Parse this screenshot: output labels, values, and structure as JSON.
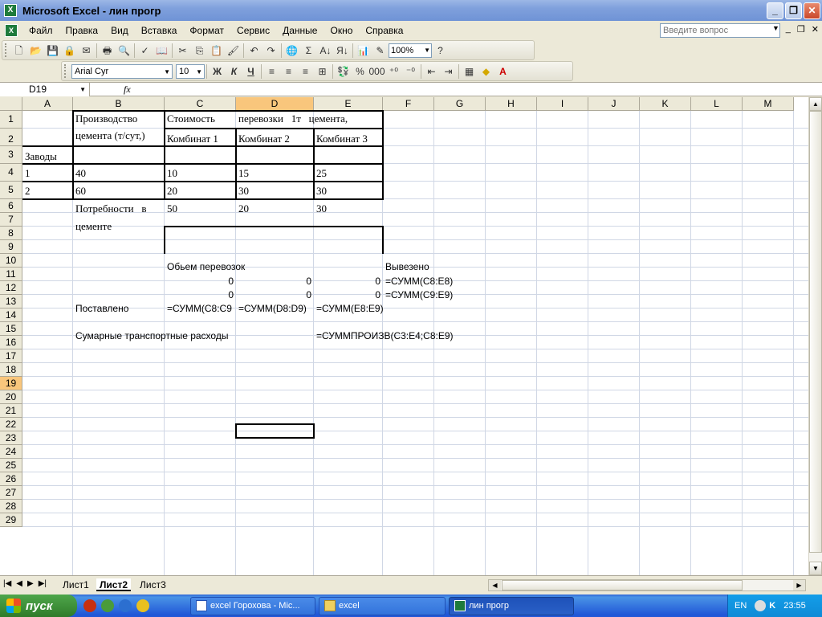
{
  "window": {
    "title": "Microsoft Excel - лин прогр",
    "app_icon": "X",
    "btn_min": "_",
    "btn_max": "❐",
    "btn_close": "✕"
  },
  "menu": {
    "items": [
      "Файл",
      "Правка",
      "Вид",
      "Вставка",
      "Формат",
      "Сервис",
      "Данные",
      "Окно",
      "Справка"
    ],
    "ask_placeholder": "Введите вопрос"
  },
  "toolbar": {
    "zoom": "100%",
    "font_name": "Arial Cyr",
    "font_size": "10",
    "bold": "Ж",
    "italic": "К",
    "underline": "Ч"
  },
  "formula_bar": {
    "name_box": "D19",
    "fx": "fx",
    "formula": ""
  },
  "columns": [
    "A",
    "B",
    "C",
    "D",
    "E",
    "F",
    "G",
    "H",
    "I",
    "J",
    "K",
    "L",
    "M"
  ],
  "rows": [
    "1",
    "2",
    "3",
    "4",
    "5",
    "6",
    "7",
    "8",
    "9",
    "10",
    "11",
    "12",
    "13",
    "14",
    "15",
    "16",
    "17",
    "18",
    "19",
    "20",
    "21",
    "22",
    "23",
    "24",
    "25",
    "26",
    "27",
    "28",
    "29"
  ],
  "cells": {
    "b1": "Производство",
    "b1b": "цемента (т/сут,)",
    "a2": "Заводы",
    "c1": "Стоимость",
    "d1": "перевозки   1т   цемента,",
    "c2": "Комбинат 1",
    "d2": "Комбинат 2",
    "e2": "Комбинат 3",
    "a3": "1",
    "b3": "40",
    "c3": "10",
    "d3": "15",
    "e3": "25",
    "a4": "2",
    "b4": "60",
    "c4": "20",
    "d4": "30",
    "e4": "30",
    "b5": "Потребности   в",
    "b5b": "цементе",
    "c5": "50",
    "d5": "20",
    "e5": "30",
    "c7": "Обьем перевозок",
    "f7": "Вывезено",
    "c8": "0",
    "d8": "0",
    "e8": "0",
    "f8": "=СУММ(C8:E8)",
    "c9": "0",
    "d9": "0",
    "e9": "0",
    "f9": "=СУММ(C9:E9)",
    "b10": "Поставлено",
    "c10": "=СУММ(C8:C9",
    "d10": "=СУММ(D8:D9)",
    "e10": "=СУММ(E8:E9)",
    "b12": "Сумарные транспортные расходы",
    "e12": "=СУММПРОИЗВ(C3:E4;C8:E9)"
  },
  "sheets": [
    "Лист1",
    "Лист2",
    "Лист3"
  ],
  "active_sheet": "Лист2",
  "taskbar": {
    "start": "пуск",
    "tasks": [
      "excel Горохова - Mic...",
      "excel",
      "лин прогр"
    ],
    "active_task": "лин прогр",
    "lang": "EN",
    "clock": "23:55"
  }
}
